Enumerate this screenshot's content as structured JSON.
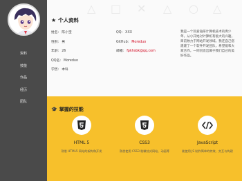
{
  "sidebar": {
    "items": [
      {
        "label": "资料"
      },
      {
        "label": "技能"
      },
      {
        "label": "作品"
      },
      {
        "label": "经历"
      },
      {
        "label": "团队"
      }
    ]
  },
  "profile": {
    "title": "个人资料",
    "left": [
      {
        "label": "姓名:",
        "value": "陈小宝"
      },
      {
        "label": "性别:",
        "value": "男"
      },
      {
        "label": "年龄:",
        "value": "26"
      },
      {
        "label": "QQ名:",
        "value": "Moreduo"
      },
      {
        "label": "学历:",
        "value": "本科"
      }
    ],
    "right": [
      {
        "label": "QQ:",
        "value": "XXX"
      },
      {
        "label": "GitHub:",
        "value": "Moreduo"
      },
      {
        "label": "邮箱:",
        "value": "fpkhsbk@qq.com"
      }
    ],
    "intro": "我是一个热爱钻研计算机技术的青少年，从小开始对计算机有极大的兴趣，目前致力于网站开发领域。我还自己搭建建了一个软件开发团队，希望能和大家合作，一同创造出属于我们自己的美好作品。"
  },
  "skills": {
    "title": "掌握的技能",
    "items": [
      {
        "icon": "html5-icon",
        "name": "HTML 5",
        "desc": "熟悉 HTML5 网站的架构和开发"
      },
      {
        "icon": "css3-icon",
        "name": "CSS3",
        "desc": "熟悉使用 CSS3 制做炫式网站、动画等"
      },
      {
        "icon": "javascript-icon",
        "name": "JavaScript",
        "desc": "能使用 JS 制作简单的特效、交互与构建"
      }
    ]
  },
  "colors": {
    "sidebar": "#4a4a4a",
    "accent": "#f7c02b",
    "link": "#d0021b"
  }
}
